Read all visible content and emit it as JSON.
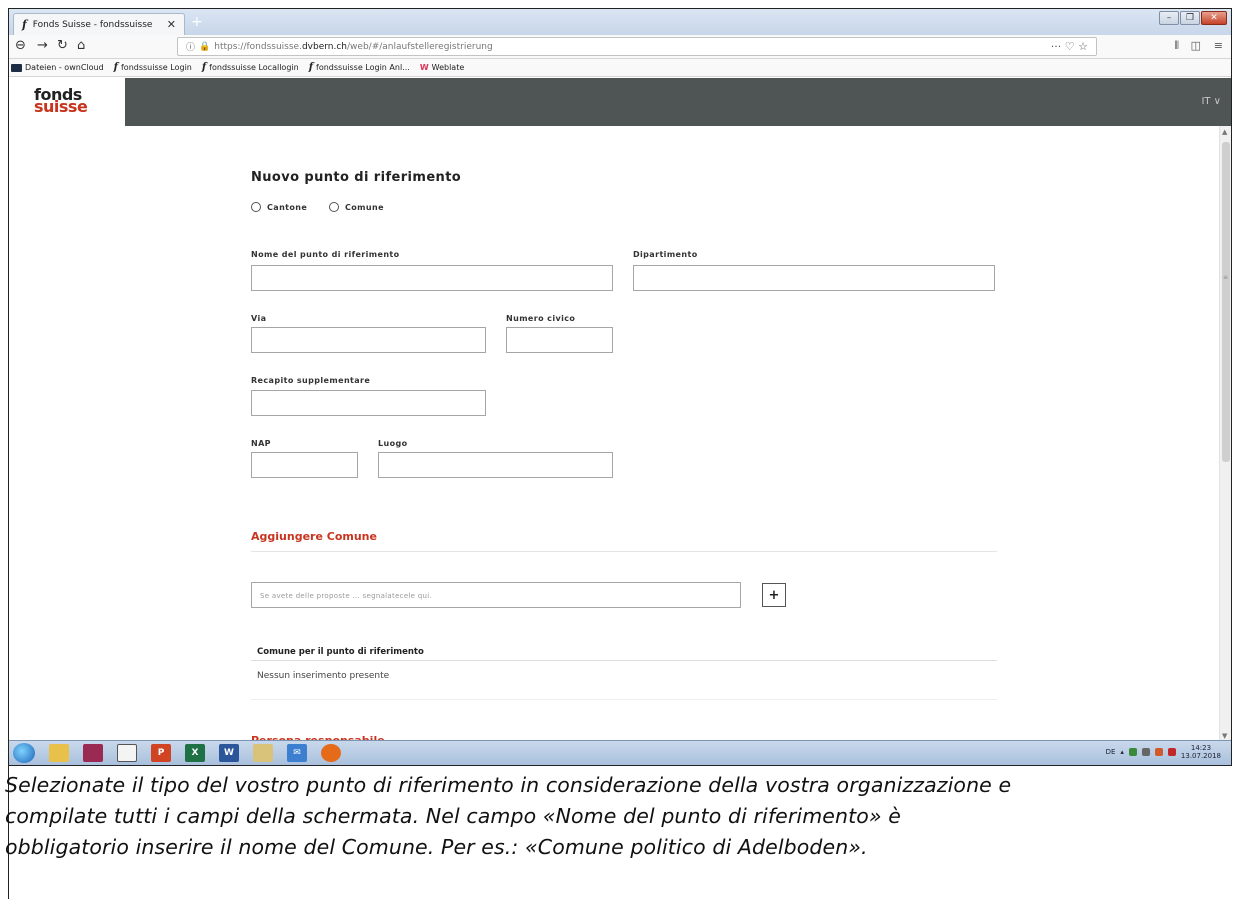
{
  "browser": {
    "tab_title": "Fonds Suisse - fondssuisse",
    "tab_favicon": "f",
    "url_prefix": "https://fondssuisse.",
    "url_host": "dvbern.ch",
    "url_path": "/web/#/anlaufstelleregistrierung",
    "bookmarks": [
      {
        "label": "Dateien - ownCloud",
        "icon": "cloud-icon"
      },
      {
        "label": "fondssuisse Login",
        "icon": "f-icon"
      },
      {
        "label": "fondssuisse Locallogin",
        "icon": "f-icon"
      },
      {
        "label": "fondssuisse Login Anl...",
        "icon": "f-icon"
      },
      {
        "label": "Weblate",
        "icon": "weblate-icon"
      }
    ]
  },
  "site": {
    "logo_line1": "fonds",
    "logo_line2": "suisse",
    "lang": "IT ∨",
    "brand_color": "#c8341e",
    "header_color": "#4f5455"
  },
  "form": {
    "title": "Nuovo punto di riferimento",
    "radio_cantone": "Cantone",
    "radio_comune": "Comune",
    "label_nome": "Nome del punto di riferimento",
    "label_dipartimento": "Dipartimento",
    "label_via": "Via",
    "label_numero": "Numero civico",
    "label_recapito": "Recapito supplementare",
    "label_nap": "NAP",
    "label_luogo": "Luogo",
    "section_comune": "Aggiungere Comune",
    "suggest_placeholder": "Se avete delle proposte ... segnalatecele qui.",
    "add_button": "+",
    "comune_list_header": "Comune per il punto di riferimento",
    "comune_empty": "Nessun inserimento presente",
    "section_persona": "Persona responsabile"
  },
  "taskbar": {
    "lang": "DE",
    "time": "14:23",
    "date": "13.07.2018"
  },
  "caption": {
    "line1": "Selezionate il tipo del vostro punto di riferimento in considerazione della vostra organizzazione e",
    "line2": "compilate tutti i campi della schermata. Nel campo «Nome del punto di riferimento» è",
    "line3": "obbligatorio inserire il nome del Comune. Per es.: «Comune politico di Adelboden»."
  }
}
